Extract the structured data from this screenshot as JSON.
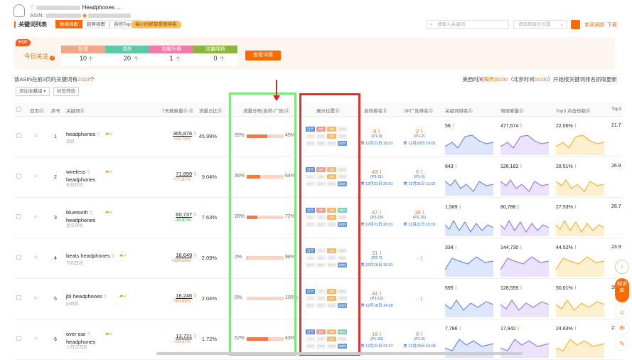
{
  "product": {
    "title_suffix": "Headphones ...",
    "asin_label": "ASIN:"
  },
  "toolbar": {
    "section_title": "关键词列表",
    "tabs": [
      "数据视图",
      "趋势视图",
      "自然Top10"
    ],
    "fetch_badge": "每小时抓取爱搜排名",
    "search_placeholder": "请输入关键词",
    "select_placeholder": "请选择展示位置",
    "single_word": "单词词频",
    "download": "下载"
  },
  "today": {
    "hot": "HOT",
    "label": "今日关注",
    "cards": [
      {
        "title": "新增",
        "value": "10",
        "color": "#f2a68a"
      },
      {
        "title": "流失",
        "value": "20",
        "color": "#5ec9a8"
      },
      {
        "title": "流量升档",
        "value": "1",
        "color": "#f07aa8"
      },
      {
        "title": "流量降档",
        "value": "0",
        "color": "#88b83a"
      }
    ],
    "detail_button": "查看详情"
  },
  "info": {
    "left_prefix": "该ASIN在前3页的关键词有",
    "count": "2103",
    "left_suffix": "个",
    "right_prefix": "美西时间",
    "right_time1": "每天00:00",
    "right_mid": "（北京时间",
    "right_time2": "16:00",
    "right_suffix": "）开始按关键词排名抓取更新"
  },
  "buttons": {
    "add_group": "添加收藏组 ▾",
    "tag_filter": "标签筛选"
  },
  "headers": {
    "collect": "首页⓪",
    "no": "序号",
    "keyword": "关键词⓪",
    "search7": "7天搜索量⓪ ⓪",
    "share": "流量占比⓪",
    "dist": "流量分布(自然-广告)⓪",
    "pos": "展示位置⓪",
    "natural": "自然排名⓪",
    "sp": "SP广告排名⓪",
    "kwrank": "关键词排名⓪",
    "volume": "周搜索量⓪",
    "top3": "Top3 点击份额⓪",
    "top3b": "Top3"
  },
  "chips": [
    "自然",
    "SP",
    "SB",
    "SBV",
    "AC",
    "ER",
    "HR",
    "TRS",
    "OPP",
    "ODR",
    "EDR",
    "SOR"
  ],
  "rows": [
    {
      "no": "1",
      "kw1": "headphones",
      "kw2": "",
      "cn": "耳机",
      "vol": "365,876",
      "delta": "+34.76%",
      "delta_dir": "up",
      "share": "45.99%",
      "nat": 55,
      "ad": 45,
      "nat_label": "55%",
      "ad_label": "45%",
      "chips_on": [
        0,
        1,
        2,
        6,
        11
      ],
      "rank": "9",
      "rank_sub": "(P1-9)",
      "rank_date": "美 12月21日 19:01",
      "sp": "2",
      "sp_sub": "(P1-2)",
      "sp_date": "美 12月20日 19:01",
      "kwv": "58",
      "wv": "477,674",
      "t3": "22.06%",
      "t3b": "21.7"
    },
    {
      "no": "2",
      "kw1": "wireless",
      "kw2": "headphones",
      "cn": "无线耳机",
      "vol": "71,899",
      "delta": "+70.87%",
      "delta_dir": "up",
      "share": "9.04%",
      "nat": 36,
      "ad": 64,
      "nat_label": "36%",
      "ad_label": "64%",
      "chips_on": [
        0,
        1,
        2,
        6,
        11
      ],
      "rank": "43",
      "rank_sub": "(P3-11)",
      "rank_date": "美 12月21日 20:01",
      "sp": "6",
      "sp_sub": "(P1-6)",
      "sp_date": "美 12月21日 11:01",
      "kwv": "643",
      "wv": "126,183",
      "t3": "28.51%",
      "t3b": "26.8"
    },
    {
      "no": "3",
      "kw1": "bluetooth",
      "kw2": "headphones",
      "cn": "蓝牙耳机",
      "vol": "60,737",
      "delta": "-18.97%",
      "delta_dir": "down",
      "share": "7.63%",
      "nat": 28,
      "ad": 72,
      "nat_label": "28%",
      "ad_label": "72%",
      "chips_on": [
        0,
        1,
        2,
        3,
        6,
        11
      ],
      "rank": "47",
      "rank_sub": "(P3-15)",
      "rank_date": "美 12月21日 20:01",
      "sp": "16",
      "sp_sub": "(P1-16)",
      "sp_date": "美 12月21日 15:01",
      "kwv": "1,569",
      "wv": "80,788",
      "t3": "27.53%",
      "t3b": "26.7"
    },
    {
      "no": "4",
      "kw1": "beats headphones",
      "kw2": "",
      "cn": "节拍耳机",
      "vol": "16,649",
      "delta": "+234.59%",
      "delta_dir": "up",
      "share": "2.09%",
      "nat": 2,
      "ad": 98,
      "nat_label": "2%",
      "ad_label": "98%",
      "chips_on": [
        0,
        2,
        11
      ],
      "rank": "31",
      "rank_sub": "(P2-7)",
      "rank_date": "美 12月16日 15:01",
      "sp": "-",
      "sp_sub": "",
      "sp_date": "",
      "kwv": "334",
      "wv": "144,730",
      "t3": "44.52%",
      "t3b": "23.9"
    },
    {
      "no": "5",
      "kw1": "jbl headphones",
      "kw2": "",
      "cn": "jbl耳机",
      "vol": "16,246",
      "delta": "+63.69%",
      "delta_dir": "up",
      "share": "2.04%",
      "nat": 0,
      "ad": 100,
      "nat_label": "0%",
      "ad_label": "100%",
      "chips_on": [
        0,
        2,
        6,
        11
      ],
      "rank": "44",
      "rank_sub": "(P3-12)",
      "rank_date": "美 12月18日 14:00",
      "sp": "-",
      "sp_sub": "",
      "sp_date": "",
      "kwv": "595",
      "wv": "128,559",
      "t3": "50.01%",
      "t3b": "39.3"
    },
    {
      "no": "6",
      "kw1": "over ear",
      "kw2": "headphones",
      "cn": "入耳式耳机",
      "vol": "13,721",
      "delta": "+58.37%",
      "delta_dir": "up",
      "share": "1.72%",
      "nat": 57,
      "ad": 43,
      "nat_label": "57%",
      "ad_label": "43%",
      "chips_on": [
        0,
        1,
        2,
        3,
        6,
        11
      ],
      "rank": "16",
      "rank_sub": "(P1-16)",
      "rank_date": "美 12月21日 21:07",
      "sp": "6",
      "sp_sub": "(P1-6)",
      "sp_date": "美 12月20日 16:05",
      "kwv": "7,786",
      "wv": "17,942",
      "t3": "24.63%",
      "t3b": "21.2"
    }
  ],
  "side": {
    "zhishi": "知识库"
  },
  "colors": {
    "accent": "#ff6a00",
    "green_highlight": "#7ee87e",
    "red_highlight": "#e03030"
  }
}
